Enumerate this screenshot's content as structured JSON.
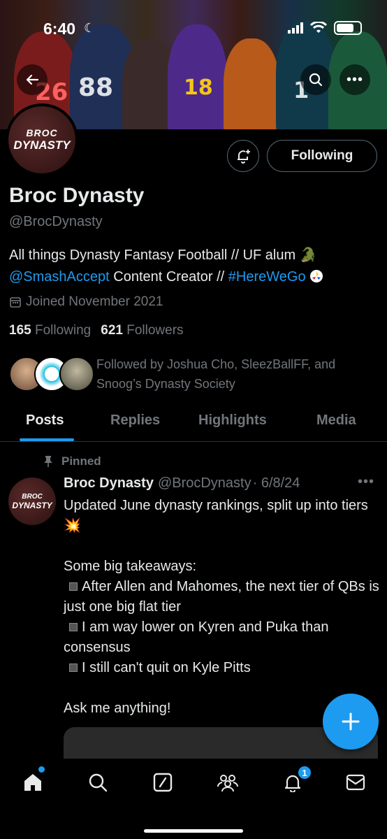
{
  "status_bar": {
    "time": "6:40"
  },
  "profile": {
    "avatar_line1": "BROC",
    "avatar_line2": "DYNASTY",
    "name": "Broc Dynasty",
    "handle": "@BrocDynasty",
    "bio_text1": "All things Dynasty Fantasy Football // UF alum ",
    "bio_link1": "@SmashAccept",
    "bio_text2": " Content Creator // ",
    "bio_link2": "#HereWeGo",
    "joined": "Joined November 2021",
    "following_count": "165",
    "following_label": "Following",
    "followers_count": "621",
    "followers_label": "Followers",
    "followed_by": "Followed by Joshua Cho, SleezBallFF, and Snoog’s Dynasty Society"
  },
  "actions": {
    "following_button": "Following"
  },
  "tabs": [
    {
      "label": "Posts",
      "active": true
    },
    {
      "label": "Replies",
      "active": false
    },
    {
      "label": "Highlights",
      "active": false
    },
    {
      "label": "Media",
      "active": false
    }
  ],
  "post": {
    "pinned_label": "Pinned",
    "author_name": "Broc Dynasty",
    "author_handle": "@BrocDynasty",
    "date": "· 6/8/24",
    "line1": "Updated June dynasty rankings, split up into tiers",
    "takeaways_title": "Some big takeaways:",
    "bullet1": "After Allen and Mahomes, the next tier of QBs is just one big flat tier",
    "bullet2": "I am way lower on Kyren and Puka than consensus",
    "bullet3": "I still can't quit on Kyle Pitts",
    "closing": "Ask me anything!"
  },
  "banner_numbers": [
    "26",
    "88",
    "18",
    "1"
  ],
  "bottom_nav": {
    "notification_badge": "1",
    "items": [
      "home-icon",
      "search-icon",
      "grok-icon",
      "communities-icon",
      "notifications-icon",
      "messages-icon"
    ]
  },
  "colors": {
    "accent": "#1d9bf0",
    "muted": "#71767b",
    "text": "#e7e9ea",
    "background": "#000000"
  }
}
